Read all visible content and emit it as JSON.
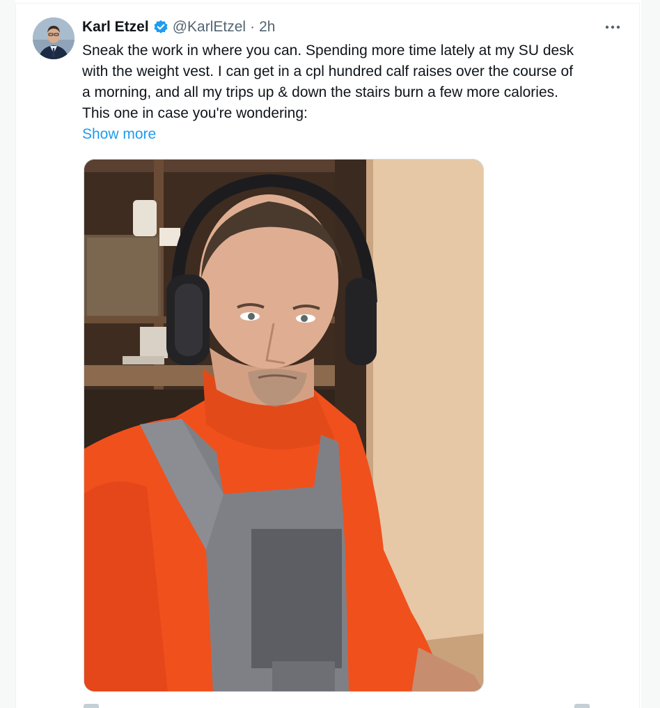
{
  "tweet": {
    "author_name": "Karl Etzel",
    "handle": "@KarlEtzel",
    "separator": "·",
    "time": "2h",
    "body_lines": [
      "Sneak the work in where you can.  Spending more time lately at my SU desk",
      "with the weight vest.   I can get in a cpl hundred calf raises over the course of",
      "a morning, and all my trips up & down the stairs burn a few more calories.",
      "This one in case you're wondering:"
    ],
    "show_more": "Show more",
    "more_icon": "more-horizontal-icon",
    "verified_icon": "verified-badge-icon",
    "verified_color": "#1d9bf0",
    "link_color": "#1d9bf0"
  }
}
